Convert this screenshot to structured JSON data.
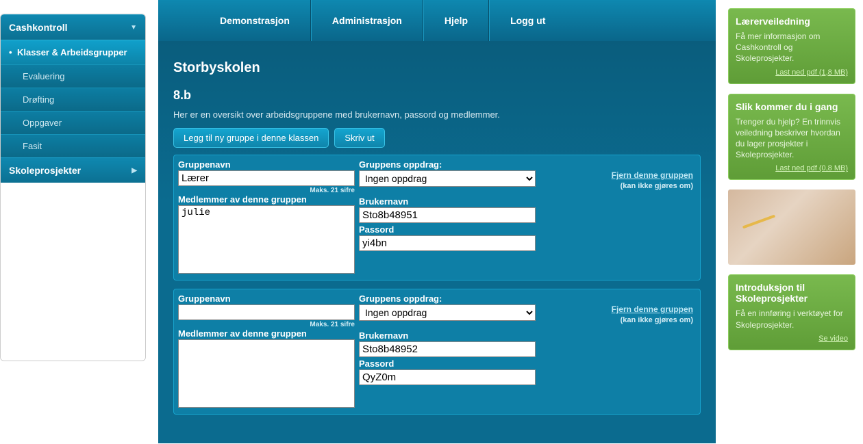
{
  "topnav": [
    {
      "label": "Demonstrasjon"
    },
    {
      "label": "Administrasjon"
    },
    {
      "label": "Hjelp"
    },
    {
      "label": "Logg ut"
    }
  ],
  "sidebar": {
    "section1": "Cashkontroll",
    "active": "Klasser & Arbeidsgrupper",
    "items": [
      "Evaluering",
      "Drøfting",
      "Oppgaver",
      "Fasit"
    ],
    "section2": "Skoleprosjekter"
  },
  "main": {
    "title": "Storbyskolen",
    "class": "8.b",
    "intro": "Her er en oversikt over arbeidsgruppene med brukernavn, passord og medlemmer.",
    "add_btn": "Legg til ny gruppe i denne klassen",
    "print_btn": "Skriv ut",
    "labels": {
      "groupname": "Gruppenavn",
      "assignment": "Gruppens oppdrag:",
      "maxhint": "Maks. 21 sifre",
      "members": "Medlemmer av denne gruppen",
      "username": "Brukernavn",
      "password": "Passord",
      "remove": "Fjern denne gruppen",
      "remove_note": "(kan ikke gjøres om)",
      "assign_option": "Ingen oppdrag"
    },
    "groups": [
      {
        "name": "Lærer",
        "members": "julie",
        "user": "Sto8b48951",
        "pass": "yi4bn"
      },
      {
        "name": "",
        "members": "",
        "user": "Sto8b48952",
        "pass": "QyZ0m"
      }
    ]
  },
  "right": {
    "c1": {
      "title": "Lærerveiledning",
      "body": "Få mer informasjon om Cashkontroll og Skoleprosjekter.",
      "link": "Last ned pdf (1,8 MB)"
    },
    "c2": {
      "title": "Slik kommer du i gang",
      "body": "Trenger du hjelp? En trinnvis veiledning beskriver hvordan du lager prosjekter i Skoleprosjekter.",
      "link": "Last ned pdf (0,8 MB)"
    },
    "c3": {
      "title": "Introduksjon til Skoleprosjekter",
      "body": "Få en innføring i verktøyet for Skoleprosjekter.",
      "link": "Se video"
    }
  }
}
